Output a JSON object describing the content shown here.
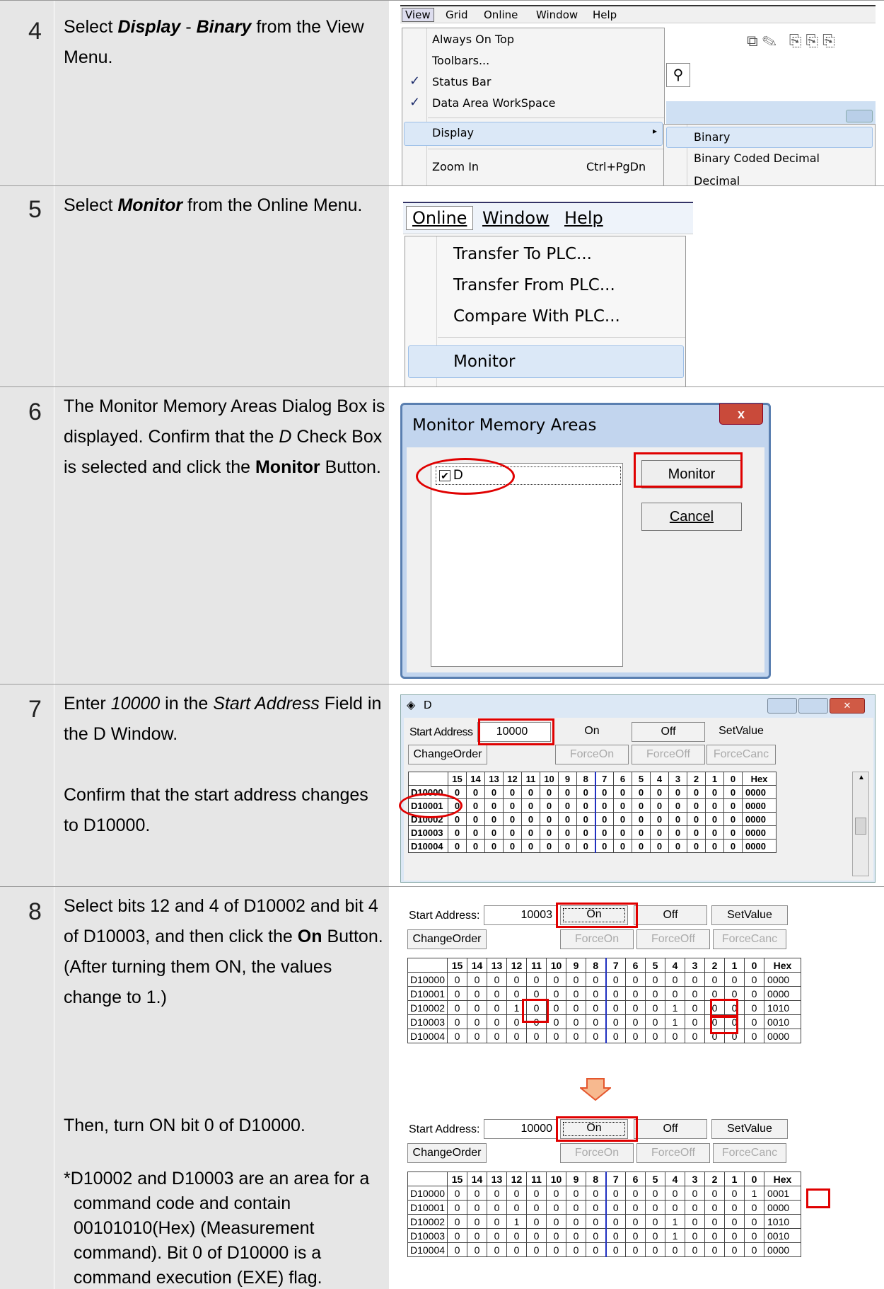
{
  "steps": [
    {
      "number": "4",
      "desc": {
        "pre": "Select ",
        "b1": "Display",
        "mid": " - ",
        "b2": "Binary",
        "post": " from the View Menu."
      },
      "menu": {
        "bar": [
          "View",
          "Grid",
          "Online",
          "Window",
          "Help"
        ],
        "items": [
          {
            "label": "Always On Top",
            "checked": false
          },
          {
            "label": "Toolbars...",
            "checked": false
          },
          {
            "label": "Status Bar",
            "checked": true
          },
          {
            "label": "Data Area WorkSpace",
            "checked": true
          },
          {
            "label": "Display",
            "checked": false
          },
          {
            "label": "Zoom In",
            "checked": false,
            "shortcut": "Ctrl+PgDn"
          }
        ],
        "submenu": [
          "Binary",
          "Binary Coded Decimal",
          "Decimal"
        ]
      }
    },
    {
      "number": "5",
      "desc": {
        "pre": "Select ",
        "b1": "Monitor",
        "post": " from the Online Menu."
      },
      "menu": {
        "bar": [
          "Online",
          "Window",
          "Help"
        ],
        "items": [
          "Transfer To PLC...",
          "Transfer From PLC...",
          "Compare With PLC...",
          "Monitor"
        ]
      }
    },
    {
      "number": "6",
      "desc": {
        "pre": "The Monitor Memory Areas Dialog Box is displayed. Confirm that the ",
        "i1": "D",
        "mid": " Check Box is selected and click the ",
        "b1": "Monitor",
        "post": " Button."
      },
      "dialog": {
        "title": "Monitor Memory Areas",
        "close": "x",
        "check_label": "D",
        "monitor": "Monitor",
        "cancel": "Cancel"
      }
    },
    {
      "number": "7",
      "desc": {
        "pre": "Enter ",
        "i1": "10000",
        "mid": " in the ",
        "i2": "Start Address",
        "post": " Field in the D Window.",
        "para2": "Confirm that the start address changes to D10000."
      },
      "window": {
        "title": "D",
        "start_label": "Start Address",
        "start_value": "10000",
        "on": "On",
        "off": "Off",
        "setvalue": "SetValue",
        "changeorder": "ChangeOrder",
        "forceon": "ForceOn",
        "forceoff": "ForceOff",
        "forcecanc": "ForceCanc"
      }
    },
    {
      "number": "8",
      "desc": {
        "pre": "Select bits 12 and 4 of D10002 and bit 4 of D10003, and then click the ",
        "b1": "On",
        "post": " Button. (After turning them ON, the values change to 1.)",
        "para2": "Then, turn ON bit 0 of D10000.",
        "note": "*D10002 and D10003 are an area for a command code and contain 00101010(Hex) (Measurement command). Bit 0 of D10000 is a command execution (EXE) flag."
      },
      "window_a": {
        "start_label": "Start Address:",
        "start_value": "10003",
        "on": "On",
        "off": "Off",
        "setvalue": "SetValue",
        "changeorder": "ChangeOrder",
        "forceon": "ForceOn",
        "forceoff": "ForceOff",
        "forcecanc": "ForceCanc"
      },
      "window_b": {
        "start_label": "Start Address:",
        "start_value": "10000",
        "on": "On",
        "off": "Off",
        "setvalue": "SetValue",
        "changeorder": "ChangeOrder",
        "forceon": "ForceOn",
        "forceoff": "ForceOff",
        "forcecanc": "ForceCanc"
      }
    }
  ],
  "grid_header": [
    "",
    "15",
    "14",
    "13",
    "12",
    "11",
    "10",
    "9",
    "8",
    "7",
    "6",
    "5",
    "4",
    "3",
    "2",
    "1",
    "0",
    "Hex"
  ],
  "grid7": [
    [
      "D10000",
      "0",
      "0",
      "0",
      "0",
      "0",
      "0",
      "0",
      "0",
      "0",
      "0",
      "0",
      "0",
      "0",
      "0",
      "0",
      "0",
      "0000"
    ],
    [
      "D10001",
      "0",
      "0",
      "0",
      "0",
      "0",
      "0",
      "0",
      "0",
      "0",
      "0",
      "0",
      "0",
      "0",
      "0",
      "0",
      "0",
      "0000"
    ],
    [
      "D10002",
      "0",
      "0",
      "0",
      "0",
      "0",
      "0",
      "0",
      "0",
      "0",
      "0",
      "0",
      "0",
      "0",
      "0",
      "0",
      "0",
      "0000"
    ],
    [
      "D10003",
      "0",
      "0",
      "0",
      "0",
      "0",
      "0",
      "0",
      "0",
      "0",
      "0",
      "0",
      "0",
      "0",
      "0",
      "0",
      "0",
      "0000"
    ],
    [
      "D10004",
      "0",
      "0",
      "0",
      "0",
      "0",
      "0",
      "0",
      "0",
      "0",
      "0",
      "0",
      "0",
      "0",
      "0",
      "0",
      "0",
      "0000"
    ]
  ],
  "grid8a": [
    [
      "D10000",
      "0",
      "0",
      "0",
      "0",
      "0",
      "0",
      "0",
      "0",
      "0",
      "0",
      "0",
      "0",
      "0",
      "0",
      "0",
      "0",
      "0000"
    ],
    [
      "D10001",
      "0",
      "0",
      "0",
      "0",
      "0",
      "0",
      "0",
      "0",
      "0",
      "0",
      "0",
      "0",
      "0",
      "0",
      "0",
      "0",
      "0000"
    ],
    [
      "D10002",
      "0",
      "0",
      "0",
      "1",
      "0",
      "0",
      "0",
      "0",
      "0",
      "0",
      "0",
      "1",
      "0",
      "0",
      "0",
      "0",
      "1010"
    ],
    [
      "D10003",
      "0",
      "0",
      "0",
      "0",
      "0",
      "0",
      "0",
      "0",
      "0",
      "0",
      "0",
      "1",
      "0",
      "0",
      "0",
      "0",
      "0010"
    ],
    [
      "D10004",
      "0",
      "0",
      "0",
      "0",
      "0",
      "0",
      "0",
      "0",
      "0",
      "0",
      "0",
      "0",
      "0",
      "0",
      "0",
      "0",
      "0000"
    ]
  ],
  "grid8b": [
    [
      "D10000",
      "0",
      "0",
      "0",
      "0",
      "0",
      "0",
      "0",
      "0",
      "0",
      "0",
      "0",
      "0",
      "0",
      "0",
      "0",
      "1",
      "0001"
    ],
    [
      "D10001",
      "0",
      "0",
      "0",
      "0",
      "0",
      "0",
      "0",
      "0",
      "0",
      "0",
      "0",
      "0",
      "0",
      "0",
      "0",
      "0",
      "0000"
    ],
    [
      "D10002",
      "0",
      "0",
      "0",
      "1",
      "0",
      "0",
      "0",
      "0",
      "0",
      "0",
      "0",
      "1",
      "0",
      "0",
      "0",
      "0",
      "1010"
    ],
    [
      "D10003",
      "0",
      "0",
      "0",
      "0",
      "0",
      "0",
      "0",
      "0",
      "0",
      "0",
      "0",
      "1",
      "0",
      "0",
      "0",
      "0",
      "0010"
    ],
    [
      "D10004",
      "0",
      "0",
      "0",
      "0",
      "0",
      "0",
      "0",
      "0",
      "0",
      "0",
      "0",
      "0",
      "0",
      "0",
      "0",
      "0",
      "0000"
    ]
  ]
}
